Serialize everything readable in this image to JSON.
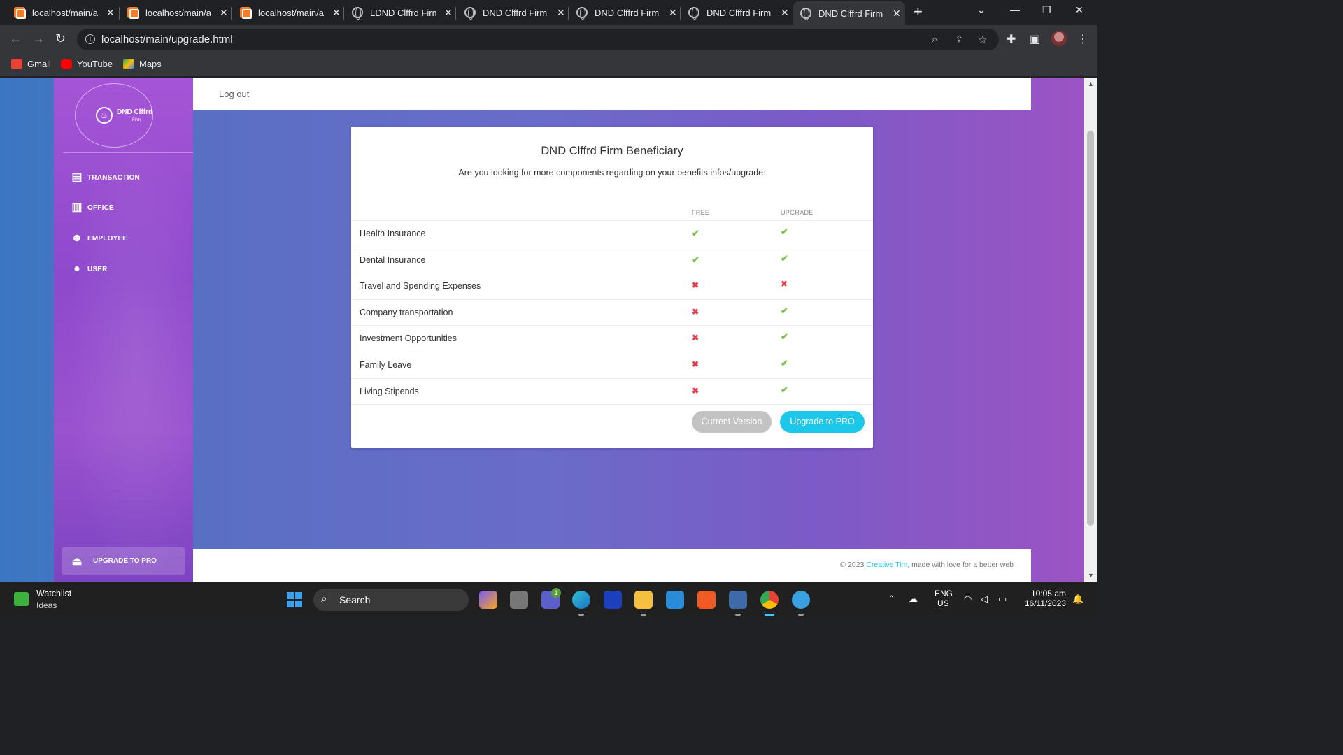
{
  "browser": {
    "tabs": [
      {
        "title": "localhost/main/a",
        "favicon": "xampp-icon",
        "active": false
      },
      {
        "title": "localhost/main/a",
        "favicon": "xampp-icon",
        "active": false
      },
      {
        "title": "localhost/main/a",
        "favicon": "xampp-icon",
        "active": false
      },
      {
        "title": "LDND Clffrd Firm",
        "favicon": "globe-icon",
        "active": false
      },
      {
        "title": "DND Clffrd Firm",
        "favicon": "globe-icon",
        "active": false
      },
      {
        "title": "DND Clffrd Firm",
        "favicon": "globe-icon",
        "active": false
      },
      {
        "title": "DND Clffrd Firm",
        "favicon": "globe-icon",
        "active": false
      },
      {
        "title": "DND Clffrd Firm",
        "favicon": "globe-icon",
        "active": true
      }
    ],
    "url": "localhost/main/upgrade.html",
    "bookmarks": [
      {
        "label": "Gmail",
        "icon": "gmail-icon",
        "color": "#ea4335"
      },
      {
        "label": "YouTube",
        "icon": "youtube-icon",
        "color": "#ff0000"
      },
      {
        "label": "Maps",
        "icon": "maps-icon",
        "color": "#34a853"
      }
    ]
  },
  "sidebar": {
    "brand": "DND Clffrd",
    "brand_sub": "Firm",
    "items": [
      {
        "label": "TRANSACTION",
        "icon": "newspaper-icon"
      },
      {
        "label": "OFFICE",
        "icon": "building-icon"
      },
      {
        "label": "EMPLOYEE",
        "icon": "users-icon"
      },
      {
        "label": "USER",
        "icon": "user-icon"
      }
    ],
    "upgrade_label": "UPGRADE TO PRO"
  },
  "topbar": {
    "logout": "Log out"
  },
  "card": {
    "title": "DND Clffrd Firm Beneficiary",
    "lead": "Are you looking for more components regarding on your benefits infos/upgrade:",
    "col_free": "FREE",
    "col_upgrade": "UPGRADE",
    "rows": [
      {
        "feature": "Health Insurance",
        "free": true,
        "upgrade": true
      },
      {
        "feature": "Dental Insurance",
        "free": true,
        "upgrade": true
      },
      {
        "feature": "Travel and Spending Expenses",
        "free": false,
        "upgrade": false
      },
      {
        "feature": "Company transportation",
        "free": false,
        "upgrade": true
      },
      {
        "feature": "Investment Opportunities",
        "free": false,
        "upgrade": true
      },
      {
        "feature": "Family Leave",
        "free": false,
        "upgrade": true
      },
      {
        "feature": "Living Stipends",
        "free": false,
        "upgrade": true
      }
    ],
    "btn_current": "Current Version",
    "btn_upgrade": "Upgrade to PRO"
  },
  "footer": {
    "prefix": "© 2023 ",
    "link": "Creative Tim",
    "suffix": ", made with love for a better web"
  },
  "colors": {
    "accent": "#1dc7ea",
    "check": "#78c142",
    "cross": "#e5404f"
  },
  "taskbar": {
    "widget_title": "Watchlist",
    "widget_sub": "Ideas",
    "search": "Search",
    "teams_badge": "1",
    "lang": "ENG",
    "region": "US",
    "time": "10:05 am",
    "date": "16/11/2023"
  }
}
